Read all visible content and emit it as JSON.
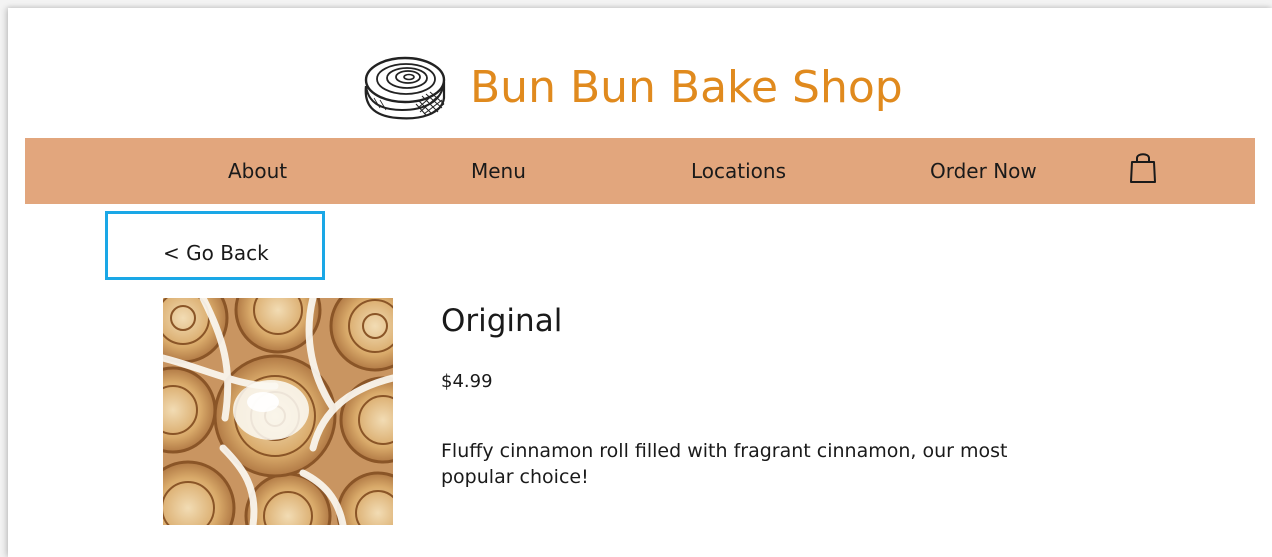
{
  "site": {
    "brand_name": "Bun Bun Bake Shop",
    "brand_color": "#e08a1e",
    "logo_icon": "cinnamon-roll-icon"
  },
  "nav": {
    "background_color": "#e2a67d",
    "items": [
      {
        "label": "About"
      },
      {
        "label": "Menu"
      },
      {
        "label": "Locations"
      },
      {
        "label": "Order Now"
      }
    ],
    "cart_icon": "shopping-bag-icon"
  },
  "back_link": {
    "label": "< Go Back",
    "highlight_color": "#1aa7e6"
  },
  "product": {
    "name": "Original",
    "price": "$4.99",
    "description": "Fluffy cinnamon roll filled with fragrant cinnamon, our most popular choice!"
  }
}
